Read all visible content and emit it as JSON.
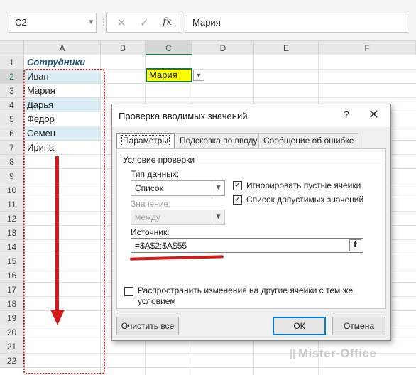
{
  "formula_bar": {
    "name_box": "C2",
    "name_box_dropdown": "▾",
    "separator": "⋮",
    "cancel_icon": "✕",
    "enter_icon": "✓",
    "fx_label": "fx",
    "value": "Мария"
  },
  "columns": [
    "A",
    "B",
    "C",
    "D",
    "E",
    "F"
  ],
  "rows": [
    "1",
    "2",
    "3",
    "4",
    "5",
    "6",
    "7",
    "8",
    "9",
    "10",
    "11",
    "12",
    "13",
    "14",
    "15",
    "16",
    "17",
    "18",
    "19",
    "20",
    "21",
    "22"
  ],
  "cells": {
    "A1": "Сотрудники",
    "A2": "Иван",
    "A3": "Мария",
    "A4": "Дарья",
    "A5": "Федор",
    "A6": "Семен",
    "A7": "Ирина",
    "C2": "Мария"
  },
  "dialog": {
    "title": "Проверка вводимых значений",
    "help": "?",
    "close": "✕",
    "tabs": [
      "Параметры",
      "Подсказка по вводу",
      "Сообщение об ошибке"
    ],
    "active_tab": 0,
    "group_label": "Условие проверки",
    "data_type_label": "Тип данных:",
    "data_type_value": "Список",
    "ignore_blank_label": "Игнорировать пустые ячейки",
    "ignore_blank_checked": true,
    "dropdown_list_label": "Список допустимых значений",
    "dropdown_list_checked": true,
    "value_label": "Значение:",
    "value_value": "между",
    "source_label": "Источник:",
    "source_value": "=$A$2:$A$55",
    "apply_all_label": "Распространить изменения на другие ячейки с тем же условием",
    "apply_all_checked": false,
    "clear_button": "Очистить все",
    "ok_button": "ОК",
    "cancel_button": "Отмена"
  },
  "watermark": "Mister-Office",
  "colors": {
    "accent_green": "#217346",
    "highlight_yellow": "#ffff00",
    "annotation_red": "#d11a1a",
    "alt_row_blue": "#dbeef5"
  }
}
